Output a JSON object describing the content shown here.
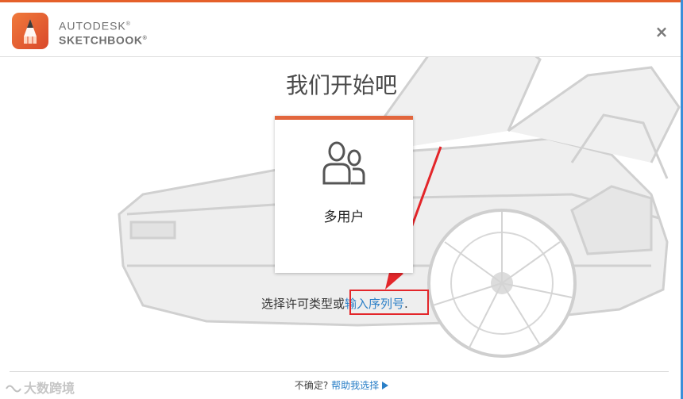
{
  "brand": {
    "line1": "AUTODESK",
    "line2": "SKETCHBOOK",
    "reg_mark": "®"
  },
  "header": {
    "close_glyph": "×"
  },
  "main": {
    "title": "我们开始吧",
    "card": {
      "label": "多用户",
      "icon": "multi-user-icon"
    },
    "license": {
      "prefix": "选择许可类型或",
      "link": "输入序列号",
      "suffix": "."
    }
  },
  "footer": {
    "question": "不确定? ",
    "link": "帮助我选择"
  },
  "watermark": {
    "text": "大数跨境"
  },
  "colors": {
    "accent": "#e2663d",
    "link": "#2a7fc7",
    "highlight": "#e3262a"
  }
}
